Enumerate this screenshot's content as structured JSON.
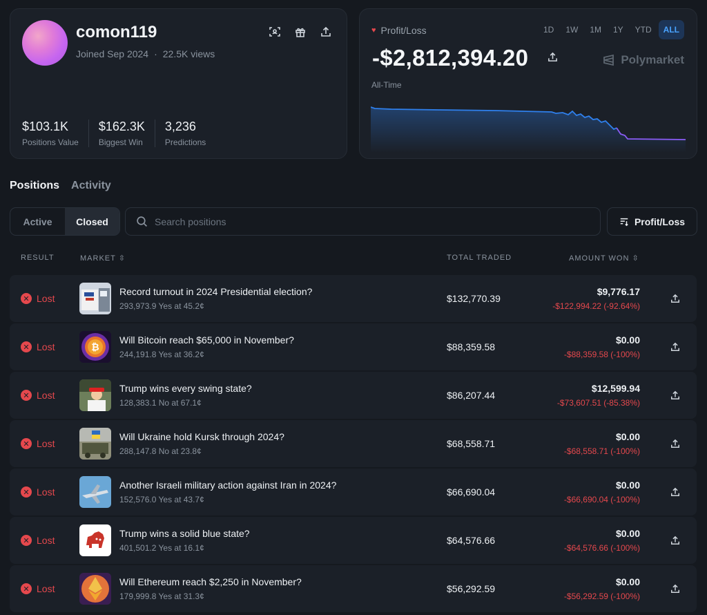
{
  "profile": {
    "username": "comon119",
    "joined": "Joined Sep 2024",
    "views": "22.5K views",
    "stats": [
      {
        "value": "$103.1K",
        "label": "Positions Value"
      },
      {
        "value": "$162.3K",
        "label": "Biggest Win"
      },
      {
        "value": "3,236",
        "label": "Predictions"
      }
    ]
  },
  "pnl": {
    "label": "Profit/Loss",
    "ranges": [
      "1D",
      "1W",
      "1M",
      "1Y",
      "YTD",
      "ALL"
    ],
    "active_range": "ALL",
    "value": "-$2,812,394.20",
    "brand": "Polymarket",
    "period": "All-Time"
  },
  "tabs": {
    "positions": "Positions",
    "activity": "Activity"
  },
  "filters": {
    "active": "Active",
    "closed": "Closed",
    "search_placeholder": "Search positions",
    "sort_label": "Profit/Loss"
  },
  "table": {
    "headers": {
      "result": "RESULT",
      "market": "MARKET",
      "total_traded": "TOTAL TRADED",
      "amount_won": "AMOUNT WON"
    },
    "rows": [
      {
        "result": "Lost",
        "title": "Record turnout in 2024 Presidential election?",
        "sub": "293,973.9 Yes at 45.2¢",
        "traded": "$132,770.39",
        "won": "$9,776.17",
        "loss": "-$122,994.22 (-92.64%)"
      },
      {
        "result": "Lost",
        "title": "Will Bitcoin reach $65,000 in November?",
        "sub": "244,191.8 Yes at 36.2¢",
        "traded": "$88,359.58",
        "won": "$0.00",
        "loss": "-$88,359.58 (-100%)"
      },
      {
        "result": "Lost",
        "title": "Trump wins every swing state?",
        "sub": "128,383.1 No at 67.1¢",
        "traded": "$86,207.44",
        "won": "$12,599.94",
        "loss": "-$73,607.51 (-85.38%)"
      },
      {
        "result": "Lost",
        "title": "Will Ukraine hold Kursk through 2024?",
        "sub": "288,147.8 No at 23.8¢",
        "traded": "$68,558.71",
        "won": "$0.00",
        "loss": "-$68,558.71 (-100%)"
      },
      {
        "result": "Lost",
        "title": "Another Israeli military action against Iran in 2024?",
        "sub": "152,576.0 Yes at 43.7¢",
        "traded": "$66,690.04",
        "won": "$0.00",
        "loss": "-$66,690.04 (-100%)"
      },
      {
        "result": "Lost",
        "title": "Trump wins a solid blue state?",
        "sub": "401,501.2 Yes at 16.1¢",
        "traded": "$64,576.66",
        "won": "$0.00",
        "loss": "-$64,576.66 (-100%)"
      },
      {
        "result": "Lost",
        "title": "Will Ethereum reach $2,250 in November?",
        "sub": "179,999.8 Yes at 31.3¢",
        "traded": "$56,292.59",
        "won": "$0.00",
        "loss": "-$56,292.59 (-100%)"
      }
    ]
  },
  "colors": {
    "loss_red": "#e5484d",
    "accent_blue": "#4aa3ff",
    "line_blue": "#2f80ed",
    "line_purple": "#8b5cf6"
  }
}
